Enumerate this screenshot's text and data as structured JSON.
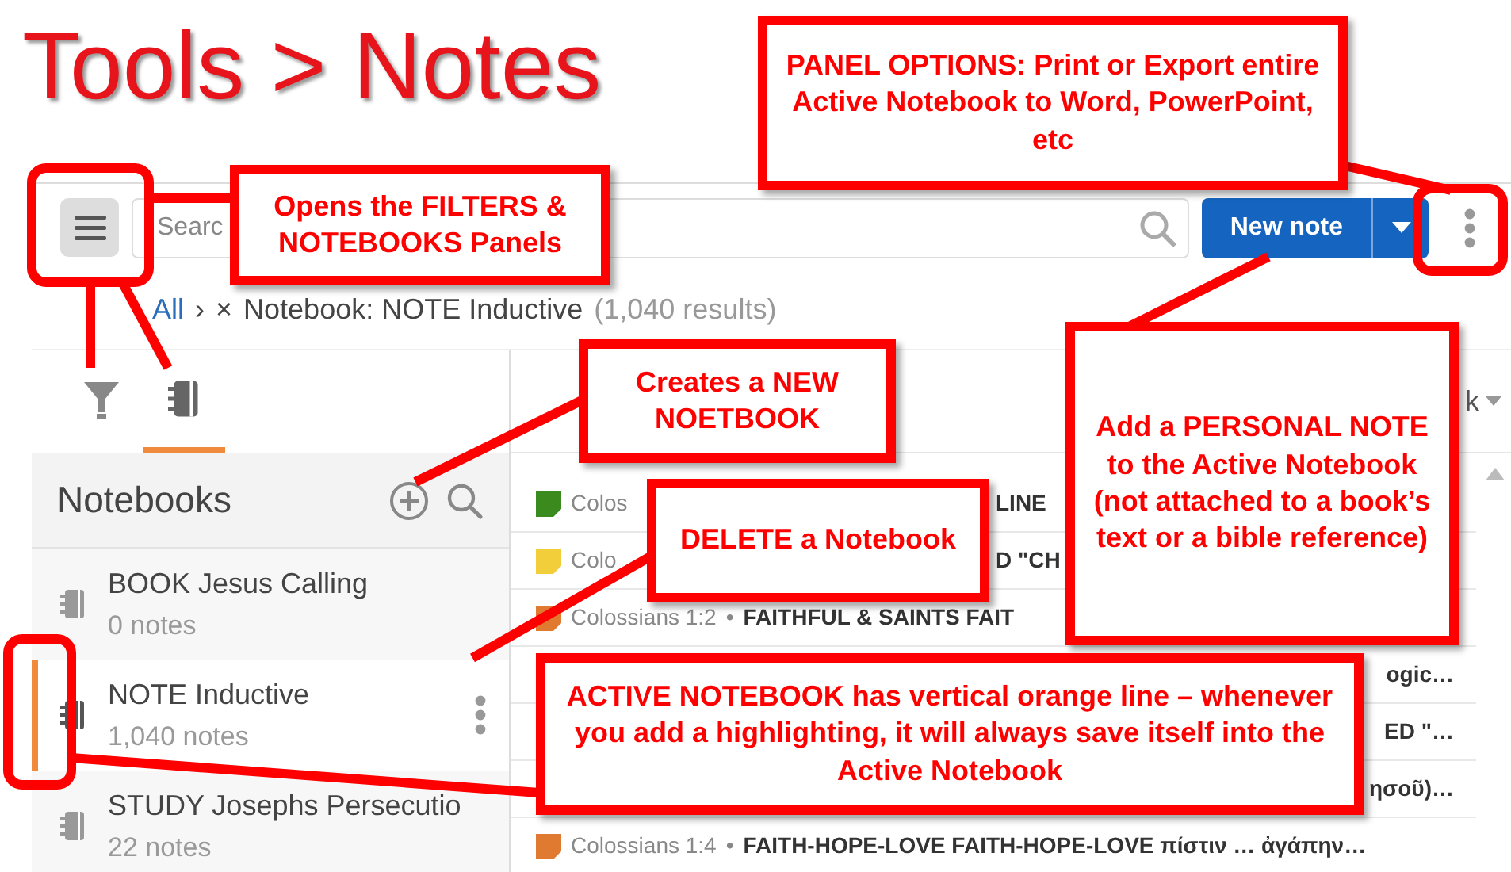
{
  "title": "Tools > Notes",
  "toolbar": {
    "search": {
      "placeholder": "Searc"
    },
    "new_note": "New note"
  },
  "breadcrumb": [
    {
      "text": "All",
      "kind": "link"
    },
    {
      "text": "›",
      "kind": "sep"
    },
    {
      "text": "×",
      "kind": "sep"
    },
    {
      "text": "Notebook: NOTE Inductive",
      "kind": "label"
    },
    {
      "text": "(1,040 results)",
      "kind": "count"
    }
  ],
  "panel_tabs": [
    {
      "kind": "filter",
      "selected": false
    },
    {
      "kind": "notebook",
      "selected": true
    }
  ],
  "notebooks": {
    "title": "Notebooks",
    "items": [
      {
        "name": "BOOK Jesus Calling",
        "count": "0 notes",
        "selected": false
      },
      {
        "name": "NOTE Inductive",
        "count": "1,040 notes",
        "selected": true
      },
      {
        "name": "STUDY Josephs Persecutio",
        "count": "22 notes",
        "selected": false
      }
    ]
  },
  "results": {
    "sort_label": "k",
    "rows": [
      {
        "kind": "note",
        "color": "#3a8a1e",
        "reference": "Colos",
        "title": "LINE"
      },
      {
        "kind": "note",
        "color": "#f2cf3a",
        "reference": "Colo",
        "title": "D \"CH"
      },
      {
        "kind": "note",
        "color": "#e07a30",
        "reference": "Colossians 1:2",
        "bullet": "•",
        "title": "FAITHFUL & SAINTS FAIT"
      },
      {
        "kind": "tail",
        "title": "ogic…"
      },
      {
        "kind": "tail",
        "title": "ED \"…"
      },
      {
        "kind": "tail",
        "title": "ησοῦ)…"
      },
      {
        "kind": "note",
        "color": "#e07a30",
        "reference": "Colossians 1:4",
        "bullet": "•",
        "title": "FAITH-HOPE-LOVE FAITH-HOPE-LOVE πίστιν … ἀγάπην…"
      }
    ]
  },
  "annotations": [
    {
      "text": "PANEL OPTIONS: Print or Export entire Active Notebook to Word, PowerPoint, etc"
    },
    {
      "text": "Opens the FILTERS & NOTEBOOKS Panels"
    },
    {
      "text": "Creates a NEW NOETBOOK"
    },
    {
      "text": "DELETE a Notebook"
    },
    {
      "text": "Add a PERSONAL NOTE to the Active Notebook (not attached to a book’s text or a bible reference)"
    },
    {
      "text": "ACTIVE NOTEBOOK has vertical orange line – whenever you add a highlighting, it will always save itself into the Active Notebook"
    }
  ]
}
